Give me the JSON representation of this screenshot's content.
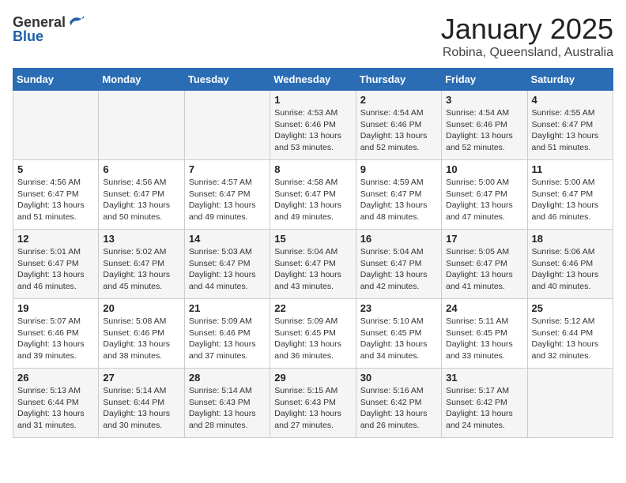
{
  "header": {
    "logo": {
      "line1": "General",
      "line2": "Blue"
    },
    "title": "January 2025",
    "subtitle": "Robina, Queensland, Australia"
  },
  "calendar": {
    "days_of_week": [
      "Sunday",
      "Monday",
      "Tuesday",
      "Wednesday",
      "Thursday",
      "Friday",
      "Saturday"
    ],
    "weeks": [
      [
        {
          "day": "",
          "info": ""
        },
        {
          "day": "",
          "info": ""
        },
        {
          "day": "",
          "info": ""
        },
        {
          "day": "1",
          "info": "Sunrise: 4:53 AM\nSunset: 6:46 PM\nDaylight: 13 hours\nand 53 minutes."
        },
        {
          "day": "2",
          "info": "Sunrise: 4:54 AM\nSunset: 6:46 PM\nDaylight: 13 hours\nand 52 minutes."
        },
        {
          "day": "3",
          "info": "Sunrise: 4:54 AM\nSunset: 6:46 PM\nDaylight: 13 hours\nand 52 minutes."
        },
        {
          "day": "4",
          "info": "Sunrise: 4:55 AM\nSunset: 6:47 PM\nDaylight: 13 hours\nand 51 minutes."
        }
      ],
      [
        {
          "day": "5",
          "info": "Sunrise: 4:56 AM\nSunset: 6:47 PM\nDaylight: 13 hours\nand 51 minutes."
        },
        {
          "day": "6",
          "info": "Sunrise: 4:56 AM\nSunset: 6:47 PM\nDaylight: 13 hours\nand 50 minutes."
        },
        {
          "day": "7",
          "info": "Sunrise: 4:57 AM\nSunset: 6:47 PM\nDaylight: 13 hours\nand 49 minutes."
        },
        {
          "day": "8",
          "info": "Sunrise: 4:58 AM\nSunset: 6:47 PM\nDaylight: 13 hours\nand 49 minutes."
        },
        {
          "day": "9",
          "info": "Sunrise: 4:59 AM\nSunset: 6:47 PM\nDaylight: 13 hours\nand 48 minutes."
        },
        {
          "day": "10",
          "info": "Sunrise: 5:00 AM\nSunset: 6:47 PM\nDaylight: 13 hours\nand 47 minutes."
        },
        {
          "day": "11",
          "info": "Sunrise: 5:00 AM\nSunset: 6:47 PM\nDaylight: 13 hours\nand 46 minutes."
        }
      ],
      [
        {
          "day": "12",
          "info": "Sunrise: 5:01 AM\nSunset: 6:47 PM\nDaylight: 13 hours\nand 46 minutes."
        },
        {
          "day": "13",
          "info": "Sunrise: 5:02 AM\nSunset: 6:47 PM\nDaylight: 13 hours\nand 45 minutes."
        },
        {
          "day": "14",
          "info": "Sunrise: 5:03 AM\nSunset: 6:47 PM\nDaylight: 13 hours\nand 44 minutes."
        },
        {
          "day": "15",
          "info": "Sunrise: 5:04 AM\nSunset: 6:47 PM\nDaylight: 13 hours\nand 43 minutes."
        },
        {
          "day": "16",
          "info": "Sunrise: 5:04 AM\nSunset: 6:47 PM\nDaylight: 13 hours\nand 42 minutes."
        },
        {
          "day": "17",
          "info": "Sunrise: 5:05 AM\nSunset: 6:47 PM\nDaylight: 13 hours\nand 41 minutes."
        },
        {
          "day": "18",
          "info": "Sunrise: 5:06 AM\nSunset: 6:46 PM\nDaylight: 13 hours\nand 40 minutes."
        }
      ],
      [
        {
          "day": "19",
          "info": "Sunrise: 5:07 AM\nSunset: 6:46 PM\nDaylight: 13 hours\nand 39 minutes."
        },
        {
          "day": "20",
          "info": "Sunrise: 5:08 AM\nSunset: 6:46 PM\nDaylight: 13 hours\nand 38 minutes."
        },
        {
          "day": "21",
          "info": "Sunrise: 5:09 AM\nSunset: 6:46 PM\nDaylight: 13 hours\nand 37 minutes."
        },
        {
          "day": "22",
          "info": "Sunrise: 5:09 AM\nSunset: 6:45 PM\nDaylight: 13 hours\nand 36 minutes."
        },
        {
          "day": "23",
          "info": "Sunrise: 5:10 AM\nSunset: 6:45 PM\nDaylight: 13 hours\nand 34 minutes."
        },
        {
          "day": "24",
          "info": "Sunrise: 5:11 AM\nSunset: 6:45 PM\nDaylight: 13 hours\nand 33 minutes."
        },
        {
          "day": "25",
          "info": "Sunrise: 5:12 AM\nSunset: 6:44 PM\nDaylight: 13 hours\nand 32 minutes."
        }
      ],
      [
        {
          "day": "26",
          "info": "Sunrise: 5:13 AM\nSunset: 6:44 PM\nDaylight: 13 hours\nand 31 minutes."
        },
        {
          "day": "27",
          "info": "Sunrise: 5:14 AM\nSunset: 6:44 PM\nDaylight: 13 hours\nand 30 minutes."
        },
        {
          "day": "28",
          "info": "Sunrise: 5:14 AM\nSunset: 6:43 PM\nDaylight: 13 hours\nand 28 minutes."
        },
        {
          "day": "29",
          "info": "Sunrise: 5:15 AM\nSunset: 6:43 PM\nDaylight: 13 hours\nand 27 minutes."
        },
        {
          "day": "30",
          "info": "Sunrise: 5:16 AM\nSunset: 6:42 PM\nDaylight: 13 hours\nand 26 minutes."
        },
        {
          "day": "31",
          "info": "Sunrise: 5:17 AM\nSunset: 6:42 PM\nDaylight: 13 hours\nand 24 minutes."
        },
        {
          "day": "",
          "info": ""
        }
      ]
    ]
  }
}
